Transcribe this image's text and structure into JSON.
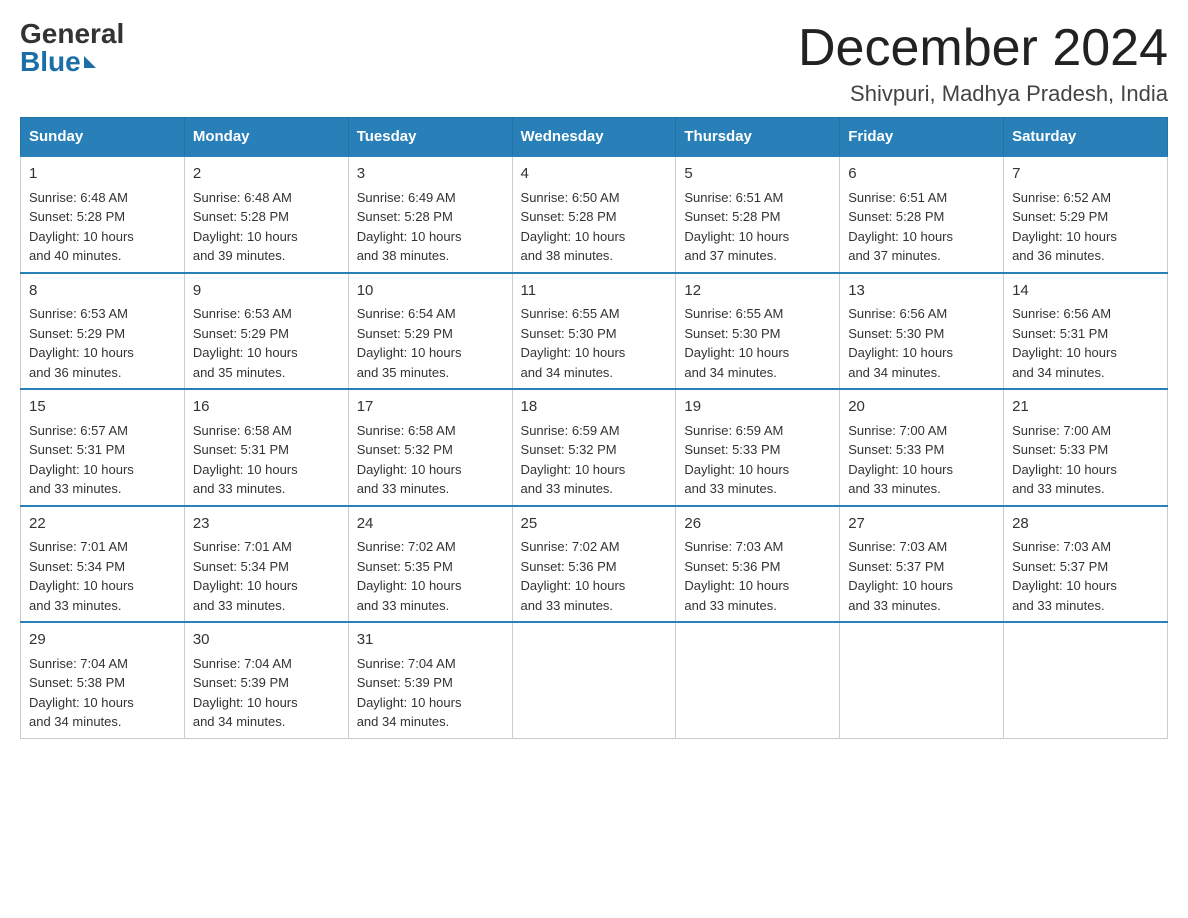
{
  "header": {
    "logo_general": "General",
    "logo_blue": "Blue",
    "month_title": "December 2024",
    "location": "Shivpuri, Madhya Pradesh, India"
  },
  "days_of_week": [
    "Sunday",
    "Monday",
    "Tuesday",
    "Wednesday",
    "Thursday",
    "Friday",
    "Saturday"
  ],
  "weeks": [
    [
      {
        "day": 1,
        "lines": [
          "Sunrise: 6:48 AM",
          "Sunset: 5:28 PM",
          "Daylight: 10 hours",
          "and 40 minutes."
        ]
      },
      {
        "day": 2,
        "lines": [
          "Sunrise: 6:48 AM",
          "Sunset: 5:28 PM",
          "Daylight: 10 hours",
          "and 39 minutes."
        ]
      },
      {
        "day": 3,
        "lines": [
          "Sunrise: 6:49 AM",
          "Sunset: 5:28 PM",
          "Daylight: 10 hours",
          "and 38 minutes."
        ]
      },
      {
        "day": 4,
        "lines": [
          "Sunrise: 6:50 AM",
          "Sunset: 5:28 PM",
          "Daylight: 10 hours",
          "and 38 minutes."
        ]
      },
      {
        "day": 5,
        "lines": [
          "Sunrise: 6:51 AM",
          "Sunset: 5:28 PM",
          "Daylight: 10 hours",
          "and 37 minutes."
        ]
      },
      {
        "day": 6,
        "lines": [
          "Sunrise: 6:51 AM",
          "Sunset: 5:28 PM",
          "Daylight: 10 hours",
          "and 37 minutes."
        ]
      },
      {
        "day": 7,
        "lines": [
          "Sunrise: 6:52 AM",
          "Sunset: 5:29 PM",
          "Daylight: 10 hours",
          "and 36 minutes."
        ]
      }
    ],
    [
      {
        "day": 8,
        "lines": [
          "Sunrise: 6:53 AM",
          "Sunset: 5:29 PM",
          "Daylight: 10 hours",
          "and 36 minutes."
        ]
      },
      {
        "day": 9,
        "lines": [
          "Sunrise: 6:53 AM",
          "Sunset: 5:29 PM",
          "Daylight: 10 hours",
          "and 35 minutes."
        ]
      },
      {
        "day": 10,
        "lines": [
          "Sunrise: 6:54 AM",
          "Sunset: 5:29 PM",
          "Daylight: 10 hours",
          "and 35 minutes."
        ]
      },
      {
        "day": 11,
        "lines": [
          "Sunrise: 6:55 AM",
          "Sunset: 5:30 PM",
          "Daylight: 10 hours",
          "and 34 minutes."
        ]
      },
      {
        "day": 12,
        "lines": [
          "Sunrise: 6:55 AM",
          "Sunset: 5:30 PM",
          "Daylight: 10 hours",
          "and 34 minutes."
        ]
      },
      {
        "day": 13,
        "lines": [
          "Sunrise: 6:56 AM",
          "Sunset: 5:30 PM",
          "Daylight: 10 hours",
          "and 34 minutes."
        ]
      },
      {
        "day": 14,
        "lines": [
          "Sunrise: 6:56 AM",
          "Sunset: 5:31 PM",
          "Daylight: 10 hours",
          "and 34 minutes."
        ]
      }
    ],
    [
      {
        "day": 15,
        "lines": [
          "Sunrise: 6:57 AM",
          "Sunset: 5:31 PM",
          "Daylight: 10 hours",
          "and 33 minutes."
        ]
      },
      {
        "day": 16,
        "lines": [
          "Sunrise: 6:58 AM",
          "Sunset: 5:31 PM",
          "Daylight: 10 hours",
          "and 33 minutes."
        ]
      },
      {
        "day": 17,
        "lines": [
          "Sunrise: 6:58 AM",
          "Sunset: 5:32 PM",
          "Daylight: 10 hours",
          "and 33 minutes."
        ]
      },
      {
        "day": 18,
        "lines": [
          "Sunrise: 6:59 AM",
          "Sunset: 5:32 PM",
          "Daylight: 10 hours",
          "and 33 minutes."
        ]
      },
      {
        "day": 19,
        "lines": [
          "Sunrise: 6:59 AM",
          "Sunset: 5:33 PM",
          "Daylight: 10 hours",
          "and 33 minutes."
        ]
      },
      {
        "day": 20,
        "lines": [
          "Sunrise: 7:00 AM",
          "Sunset: 5:33 PM",
          "Daylight: 10 hours",
          "and 33 minutes."
        ]
      },
      {
        "day": 21,
        "lines": [
          "Sunrise: 7:00 AM",
          "Sunset: 5:33 PM",
          "Daylight: 10 hours",
          "and 33 minutes."
        ]
      }
    ],
    [
      {
        "day": 22,
        "lines": [
          "Sunrise: 7:01 AM",
          "Sunset: 5:34 PM",
          "Daylight: 10 hours",
          "and 33 minutes."
        ]
      },
      {
        "day": 23,
        "lines": [
          "Sunrise: 7:01 AM",
          "Sunset: 5:34 PM",
          "Daylight: 10 hours",
          "and 33 minutes."
        ]
      },
      {
        "day": 24,
        "lines": [
          "Sunrise: 7:02 AM",
          "Sunset: 5:35 PM",
          "Daylight: 10 hours",
          "and 33 minutes."
        ]
      },
      {
        "day": 25,
        "lines": [
          "Sunrise: 7:02 AM",
          "Sunset: 5:36 PM",
          "Daylight: 10 hours",
          "and 33 minutes."
        ]
      },
      {
        "day": 26,
        "lines": [
          "Sunrise: 7:03 AM",
          "Sunset: 5:36 PM",
          "Daylight: 10 hours",
          "and 33 minutes."
        ]
      },
      {
        "day": 27,
        "lines": [
          "Sunrise: 7:03 AM",
          "Sunset: 5:37 PM",
          "Daylight: 10 hours",
          "and 33 minutes."
        ]
      },
      {
        "day": 28,
        "lines": [
          "Sunrise: 7:03 AM",
          "Sunset: 5:37 PM",
          "Daylight: 10 hours",
          "and 33 minutes."
        ]
      }
    ],
    [
      {
        "day": 29,
        "lines": [
          "Sunrise: 7:04 AM",
          "Sunset: 5:38 PM",
          "Daylight: 10 hours",
          "and 34 minutes."
        ]
      },
      {
        "day": 30,
        "lines": [
          "Sunrise: 7:04 AM",
          "Sunset: 5:39 PM",
          "Daylight: 10 hours",
          "and 34 minutes."
        ]
      },
      {
        "day": 31,
        "lines": [
          "Sunrise: 7:04 AM",
          "Sunset: 5:39 PM",
          "Daylight: 10 hours",
          "and 34 minutes."
        ]
      },
      null,
      null,
      null,
      null
    ]
  ]
}
